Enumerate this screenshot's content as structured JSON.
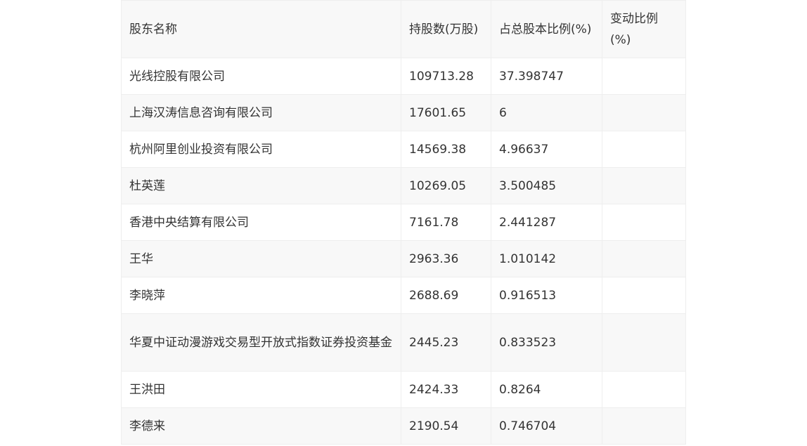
{
  "table": {
    "headers": [
      "股东名称",
      "持股数(万股)",
      "占总股本比例(%)",
      "变动比例(%)"
    ],
    "rows": [
      {
        "name": "光线控股有限公司",
        "shares": "109713.28",
        "ratio": "37.398747",
        "change": ""
      },
      {
        "name": "上海汉涛信息咨询有限公司",
        "shares": "17601.65",
        "ratio": "6",
        "change": ""
      },
      {
        "name": "杭州阿里创业投资有限公司",
        "shares": "14569.38",
        "ratio": "4.96637",
        "change": ""
      },
      {
        "name": "杜英莲",
        "shares": "10269.05",
        "ratio": "3.500485",
        "change": ""
      },
      {
        "name": "香港中央结算有限公司",
        "shares": "7161.78",
        "ratio": "2.441287",
        "change": ""
      },
      {
        "name": "王华",
        "shares": "2963.36",
        "ratio": "1.010142",
        "change": ""
      },
      {
        "name": "李晓萍",
        "shares": "2688.69",
        "ratio": "0.916513",
        "change": ""
      },
      {
        "name": "华夏中证动漫游戏交易型开放式指数证券投资基金",
        "shares": "2445.23",
        "ratio": "0.833523",
        "change": ""
      },
      {
        "name": "王洪田",
        "shares": "2424.33",
        "ratio": "0.8264",
        "change": ""
      },
      {
        "name": "李德来",
        "shares": "2190.54",
        "ratio": "0.746704",
        "change": ""
      }
    ]
  }
}
